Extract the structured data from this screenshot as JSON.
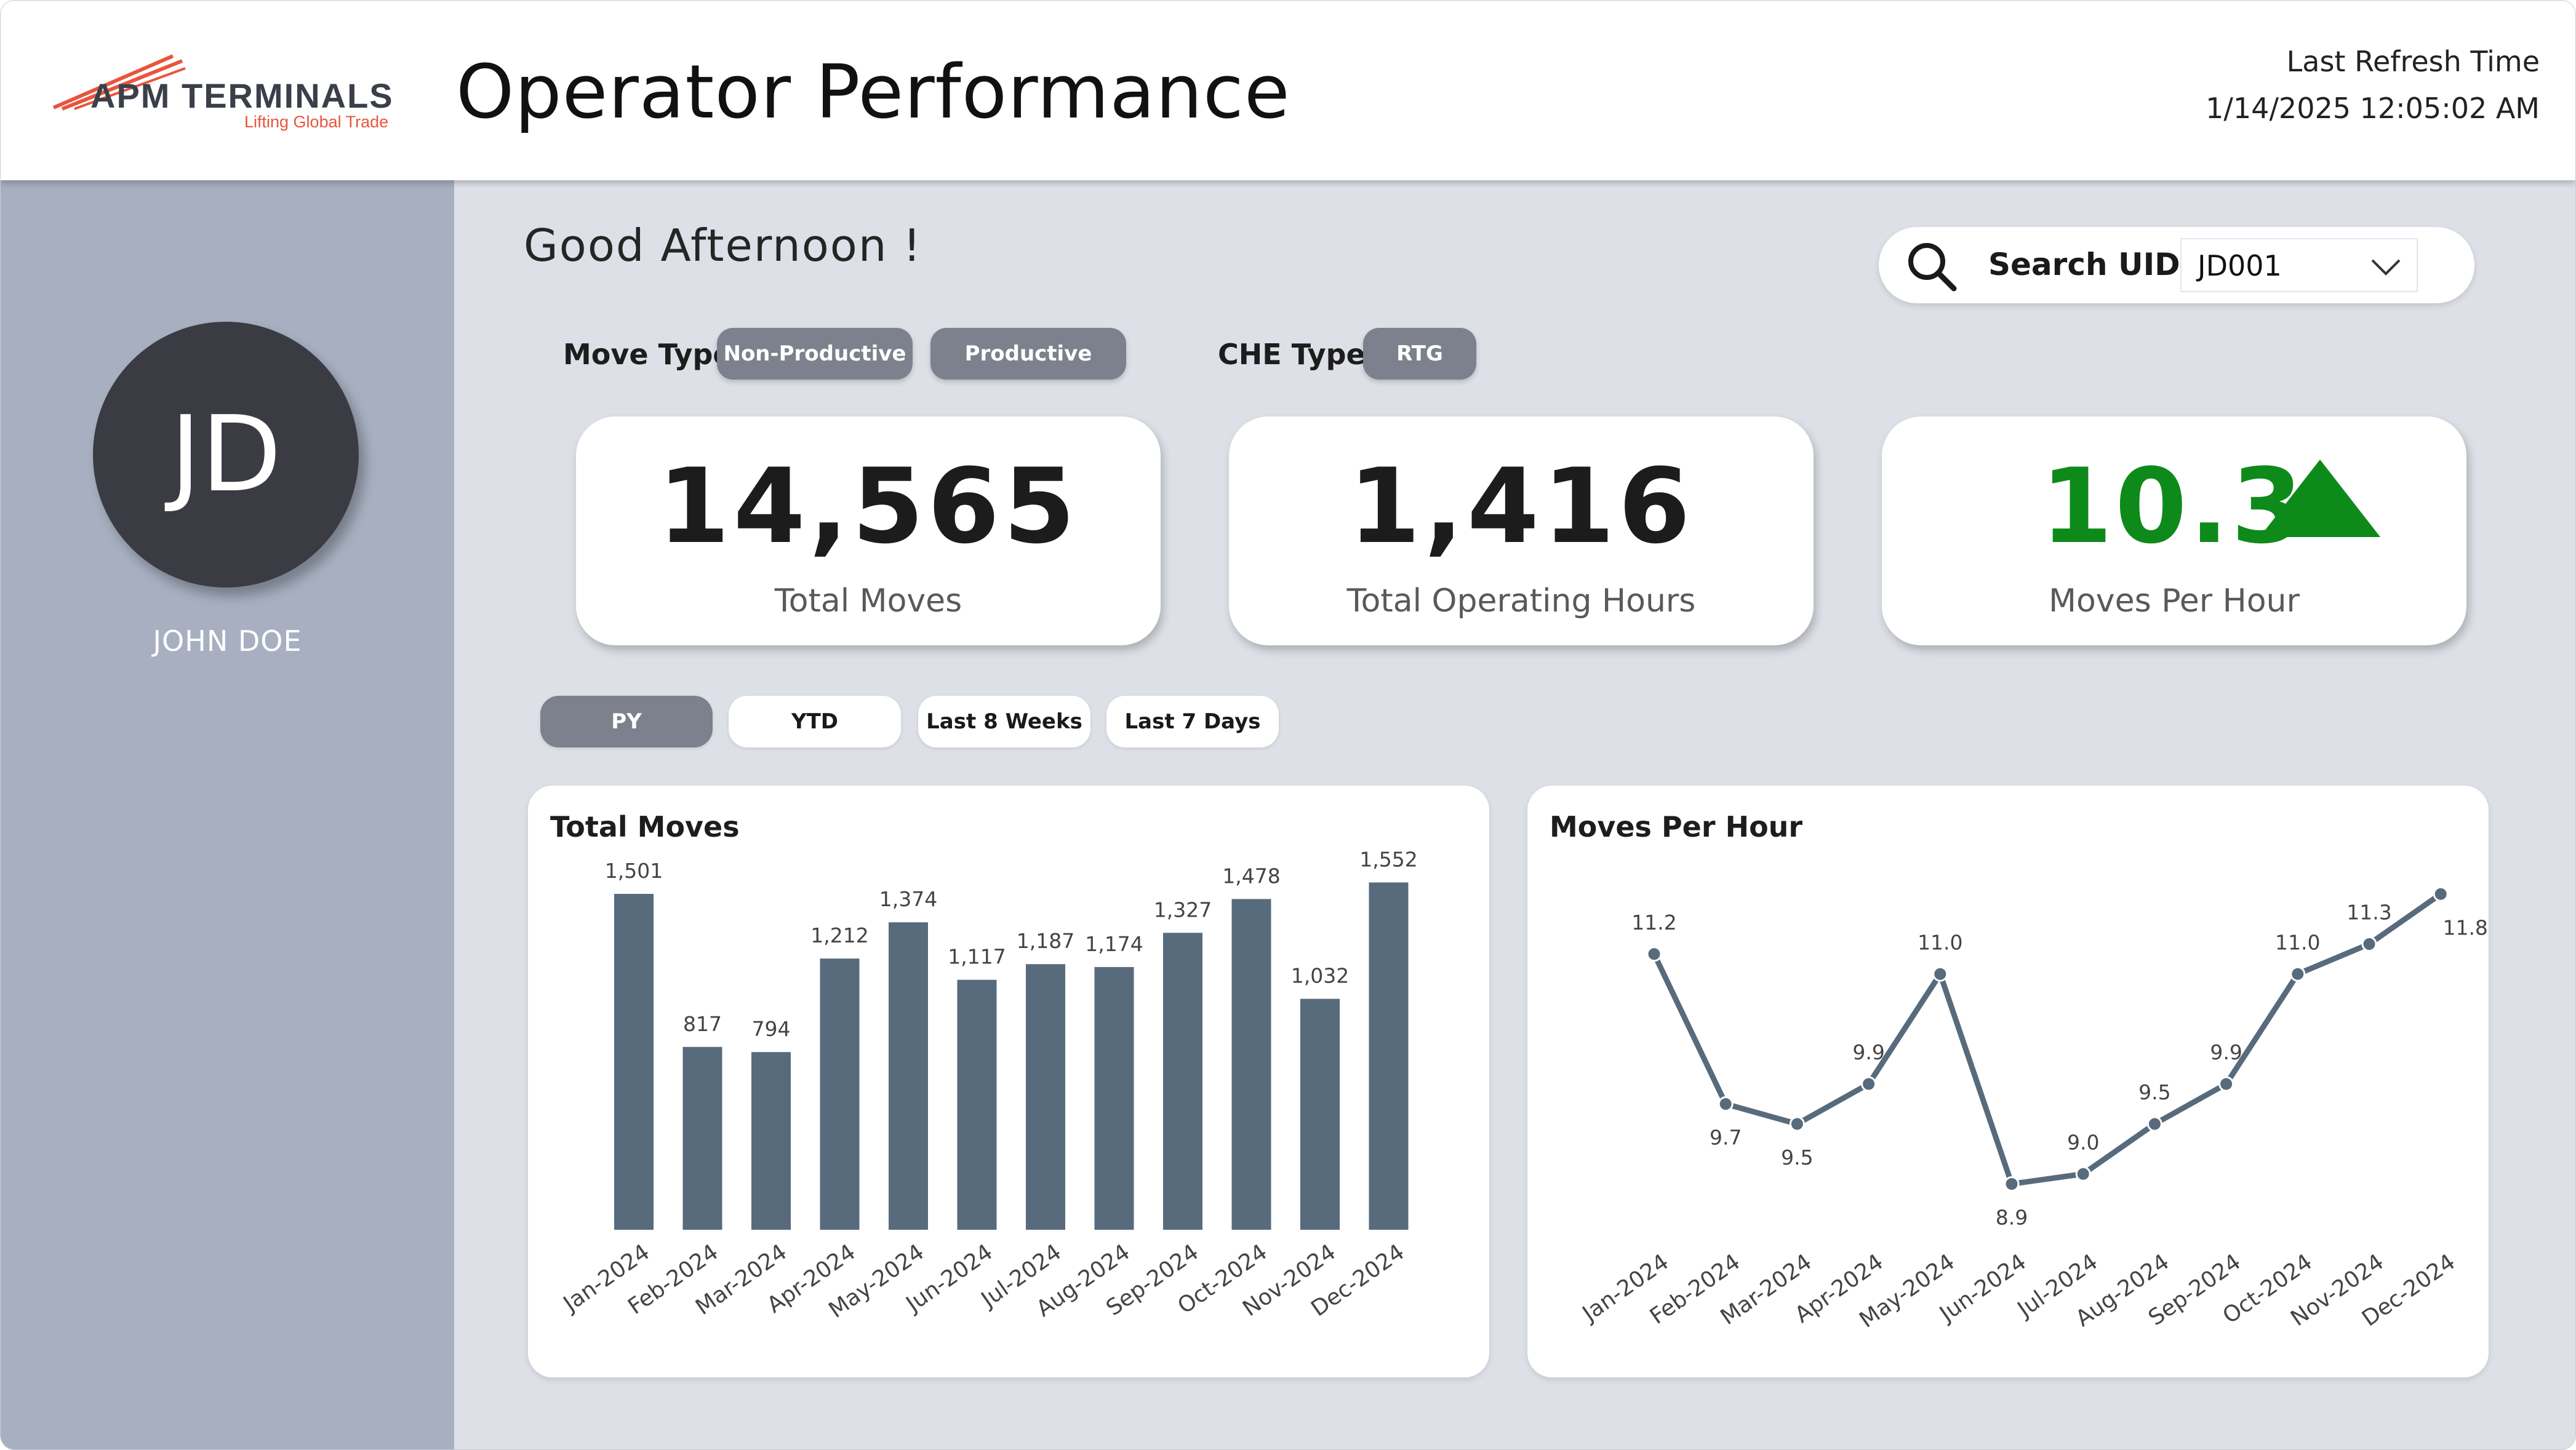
{
  "header": {
    "logo_name": "APM TERMINALS",
    "logo_tagline": "Lifting Global Trade",
    "title": "Operator Performance",
    "refresh_label": "Last Refresh Time",
    "refresh_value": "1/14/2025 12:05:02 AM"
  },
  "sidebar": {
    "avatar_initials": "JD",
    "user_name": "JOHN DOE"
  },
  "main": {
    "greeting": "Good Afternoon !",
    "search": {
      "label": "Search UID:",
      "value": "JD001"
    },
    "filters": {
      "move_type_label": "Move Type:",
      "move_types": [
        "Non-Productive",
        "Productive"
      ],
      "che_type_label": "CHE Type:",
      "che_types": [
        "RTG"
      ]
    },
    "kpis": {
      "total_moves": {
        "value": "14,565",
        "label": "Total Moves"
      },
      "total_hours": {
        "value": "1,416",
        "label": "Total Operating Hours"
      },
      "moves_per_hour": {
        "value": "10.3",
        "label": "Moves Per Hour",
        "trend": "up",
        "trend_color": "#0e8a1b"
      }
    },
    "periods": [
      "PY",
      "YTD",
      "Last 8 Weeks",
      "Last 7 Days"
    ],
    "active_period": "PY"
  },
  "colors": {
    "sidebar_bg": "#a7afc0",
    "main_bg": "#dde0e6",
    "bar_color": "#576b7c",
    "line_color": "#576b7c",
    "accent_orange": "#e8553c",
    "chip_gray": "#7c818d"
  },
  "chart_data": [
    {
      "type": "bar",
      "title": "Total Moves",
      "categories": [
        "Jan-2024",
        "Feb-2024",
        "Mar-2024",
        "Apr-2024",
        "May-2024",
        "Jun-2024",
        "Jul-2024",
        "Aug-2024",
        "Sep-2024",
        "Oct-2024",
        "Nov-2024",
        "Dec-2024"
      ],
      "values": [
        1501,
        817,
        794,
        1212,
        1374,
        1117,
        1187,
        1174,
        1327,
        1478,
        1032,
        1552
      ],
      "labels": [
        "1,501",
        "817",
        "794",
        "1,212",
        "1,374",
        "1,117",
        "1,187",
        "1,174",
        "1,327",
        "1,478",
        "1,032",
        "1,552"
      ],
      "ylim": [
        0,
        1600
      ],
      "grid": false,
      "legend": "none"
    },
    {
      "type": "line",
      "title": "Moves Per Hour",
      "categories": [
        "Jan-2024",
        "Feb-2024",
        "Mar-2024",
        "Apr-2024",
        "May-2024",
        "Jun-2024",
        "Jul-2024",
        "Aug-2024",
        "Sep-2024",
        "Oct-2024",
        "Nov-2024",
        "Dec-2024"
      ],
      "values": [
        11.2,
        9.7,
        9.5,
        9.9,
        11.0,
        8.9,
        9.0,
        9.5,
        9.9,
        11.0,
        11.3,
        11.8
      ],
      "labels": [
        "11.2",
        "9.7",
        "9.5",
        "9.9",
        "11.0",
        "8.9",
        "9.0",
        "9.5",
        "9.9",
        "11.0",
        "11.3",
        "11.8"
      ],
      "ylim": [
        8.7,
        11.9
      ],
      "grid": false,
      "legend": "none"
    }
  ]
}
